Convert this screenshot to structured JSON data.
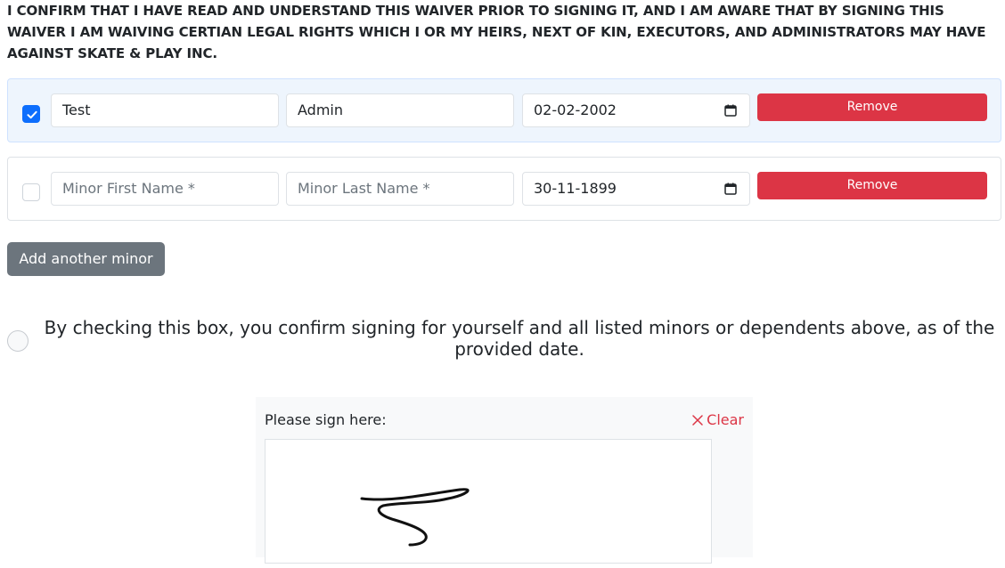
{
  "waiver": {
    "confirm_text": "I CONFIRM THAT I HAVE READ AND UNDERSTAND THIS WAIVER PRIOR TO SIGNING IT, AND I AM AWARE THAT BY SIGNING THIS WAIVER I AM WAIVING CERTIAN LEGAL RIGHTS WHICH I OR MY HEIRS, NEXT OF KIN, EXECUTORS, AND ADMINISTRATORS MAY HAVE AGAINST SKATE & PLAY INC."
  },
  "minors": [
    {
      "checked": true,
      "first_name": "Test",
      "last_name": "Admin",
      "dob": "02-02-2002",
      "remove_label": "Remove"
    },
    {
      "checked": false,
      "first_name_placeholder": "Minor First Name *",
      "last_name_placeholder": "Minor Last Name *",
      "dob": "30-11-1899",
      "remove_label": "Remove"
    }
  ],
  "add_minor_label": "Add another minor",
  "agreement": {
    "checked": false,
    "text": "By checking this box, you confirm signing for yourself and all listed minors or dependents above, as of the provided date."
  },
  "signature": {
    "label": "Please sign here:",
    "clear_label": "Clear",
    "clear_icon": "close-icon"
  },
  "colors": {
    "primary": "#0d6efd",
    "danger": "#dc3545",
    "secondary": "#6c757d",
    "selected_row_bg": "#eef5fd"
  }
}
